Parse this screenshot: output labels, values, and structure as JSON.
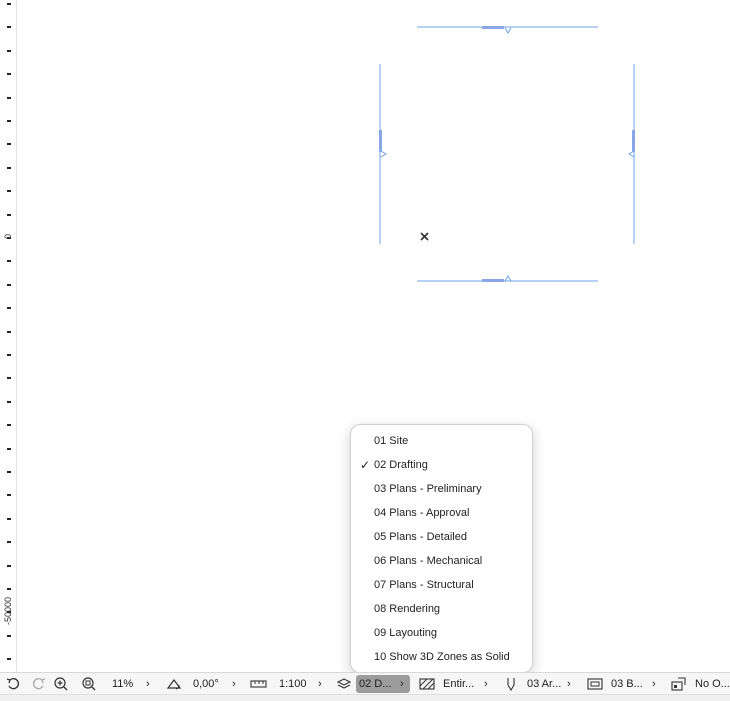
{
  "ruler": {
    "label_zero": "0",
    "label_neg": "-50000"
  },
  "menu": {
    "items": [
      {
        "label": "01 Site",
        "checked": false
      },
      {
        "label": "02 Drafting",
        "checked": true
      },
      {
        "label": "03 Plans - Preliminary",
        "checked": false
      },
      {
        "label": "04 Plans - Approval",
        "checked": false
      },
      {
        "label": "05 Plans - Detailed",
        "checked": false
      },
      {
        "label": "06 Plans - Mechanical",
        "checked": false
      },
      {
        "label": "07 Plans - Structural",
        "checked": false
      },
      {
        "label": "08 Rendering",
        "checked": false
      },
      {
        "label": "09 Layouting",
        "checked": false
      },
      {
        "label": "10 Show 3D Zones as Solid",
        "checked": false
      }
    ],
    "check_glyph": "✓"
  },
  "statusbar": {
    "zoom": "11%",
    "angle": "0,00°",
    "scale": "1:100",
    "layer_combo": "02 D...",
    "structure": "Entir...",
    "pen_set": "03 Ar...",
    "model_view": "03 B...",
    "override": "No O...",
    "chevron": "›"
  },
  "colors": {
    "accent_line": "#6ea3e6",
    "selection": "#9c9c9c"
  }
}
